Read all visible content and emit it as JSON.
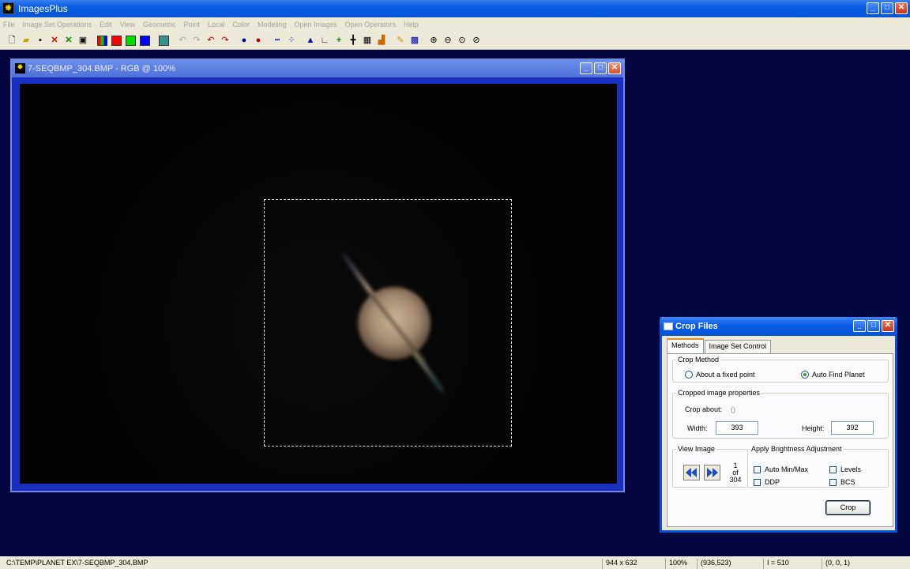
{
  "app": {
    "title": "ImagesPlus",
    "icon": "sun-icon"
  },
  "menu": [
    "File",
    "Image Set Operations",
    "Edit",
    "View",
    "Geometric",
    "Point",
    "Local",
    "Color",
    "Modeling",
    "Open Images",
    "Open Operators",
    "Help"
  ],
  "toolbar": {
    "colors": {
      "rgb": "#3a8f3a",
      "red": "#ff0000",
      "green": "#00d000",
      "blue": "#0000ff"
    }
  },
  "image_window": {
    "title": "7-SEQBMP_304.BMP - RGB @ 100%"
  },
  "crop_dialog": {
    "title": "Crop Files",
    "tabs": [
      "Methods",
      "Image Set Control"
    ],
    "crop_method": {
      "legend": "Crop Method",
      "option_fixed": "About a fixed point",
      "option_auto": "Auto Find Planet",
      "selected": "Auto Find Planet"
    },
    "properties": {
      "legend": "Cropped image properties",
      "crop_about_label": "Crop about:",
      "crop_about_value": "()",
      "width_label": "Width:",
      "width_value": "393",
      "height_label": "Height:",
      "height_value": "392"
    },
    "view_image": {
      "legend": "View Image",
      "current": "1",
      "of_label": "of",
      "total": "304"
    },
    "brightness": {
      "legend": "Apply Brightness Adjustment",
      "auto_minmax": "Auto Min/Max",
      "ddp": "DDP",
      "levels": "Levels",
      "bcs": "BCS"
    },
    "crop_button": "Crop"
  },
  "status": {
    "path": "C:\\TEMP\\PLANET EX\\7-SEQBMP_304.BMP",
    "dimensions": "944 x 632",
    "zoom": "100%",
    "cursor": "(936,523)",
    "intensity": "I = 510",
    "rgb": "(0, 0, 1)"
  }
}
